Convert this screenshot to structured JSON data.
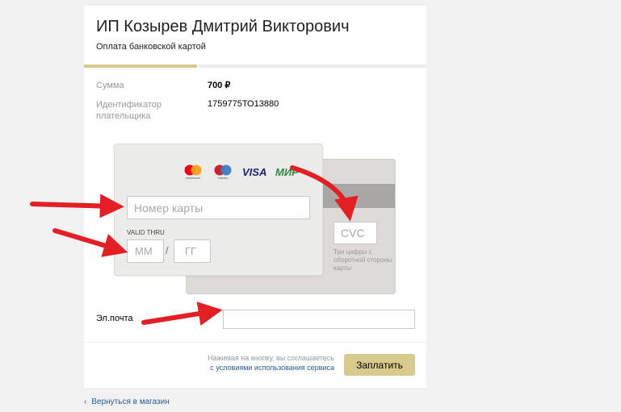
{
  "header": {
    "merchant_name": "ИП Козырев Дмитрий Викторович",
    "subtitle": "Оплата банковской картой"
  },
  "progress": {
    "step_fraction": 0.33
  },
  "details": {
    "sum_label": "Сумма",
    "sum_value": "700 ₽",
    "payer_id_label_line1": "Идентификатор",
    "payer_id_label_line2": "плательщика",
    "payer_id_value": "1759775ТО13880"
  },
  "card": {
    "number_placeholder": "Номер карты",
    "valid_thru_label": "VALID THRU",
    "month_placeholder": "ММ",
    "year_placeholder": "ГГ",
    "date_separator": "/",
    "cvc_placeholder": "CVC",
    "cvc_hint": "Три цифры с оборотной стороны карты",
    "logos": [
      {
        "icon": "mastercard-icon",
        "caption": "mastercard"
      },
      {
        "icon": "maestro-icon",
        "caption": "maestro"
      },
      {
        "icon": "visa-icon",
        "text": "VISA"
      },
      {
        "icon": "mir-icon",
        "text": "МИР"
      }
    ]
  },
  "email": {
    "label": "Эл.почта",
    "value": ""
  },
  "footer": {
    "terms_line1": "Нажимая на кнопку, вы соглашаетесь",
    "terms_line2": "с условиями использования сервиса",
    "pay_button": "Заплатить",
    "back_link": "Вернуться в магазин"
  },
  "colors": {
    "accent": "#d8c98c",
    "link": "#2a5a94",
    "annotation_arrow": "#e31e24"
  }
}
